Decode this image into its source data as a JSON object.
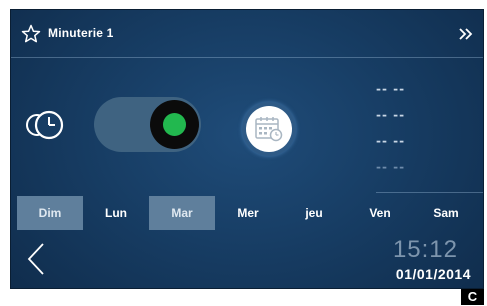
{
  "header": {
    "title": "Minuterie 1",
    "icon": "star-icon",
    "forward_icon": "double-chevron-right-icon"
  },
  "main": {
    "mode_icon": "clock-icon",
    "toggle": {
      "state": "on",
      "indicator_color": "#22b84f"
    },
    "calendar_button_icon": "calendar-clock-icon",
    "time_slots": [
      "-- --",
      "-- --",
      "-- --",
      "-- --"
    ]
  },
  "days": [
    {
      "label": "Dim",
      "selected": true
    },
    {
      "label": "Lun",
      "selected": false
    },
    {
      "label": "Mar",
      "selected": true
    },
    {
      "label": "Mer",
      "selected": false
    },
    {
      "label": "jeu",
      "selected": false
    },
    {
      "label": "Ven",
      "selected": false
    },
    {
      "label": "Sam",
      "selected": false
    }
  ],
  "footer": {
    "back_icon": "chevron-left-icon",
    "time": "15:12",
    "date": "01/01/2014"
  },
  "corner_label": "C",
  "colors": {
    "background": "#173d64",
    "selected_day": "#5f7f9c",
    "toggle_track": "#3f6381",
    "indicator_on": "#22b84f"
  }
}
